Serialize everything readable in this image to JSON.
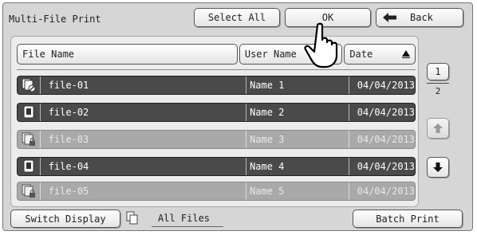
{
  "window": {
    "title": "Multi-File Print"
  },
  "toolbar": {
    "select_all": "Select All",
    "ok": "OK",
    "back": "Back"
  },
  "columns": {
    "file_name": "File Name",
    "user_name": "User Name",
    "date": "Date"
  },
  "files": [
    {
      "icon": "stapled-doc-icon",
      "name": "file-01",
      "user": "Name 1",
      "date": "04/04/2013",
      "selected": true
    },
    {
      "icon": "doc-icon",
      "name": "file-02",
      "user": "Name 2",
      "date": "04/04/2013",
      "selected": true
    },
    {
      "icon": "locked-doc-icon",
      "name": "file-03",
      "user": "Name 3",
      "date": "04/04/2013",
      "selected": false
    },
    {
      "icon": "doc-icon",
      "name": "file-04",
      "user": "Name 4",
      "date": "04/04/2013",
      "selected": true
    },
    {
      "icon": "locked-doc-icon",
      "name": "file-05",
      "user": "Name 5",
      "date": "04/04/2013",
      "selected": false
    }
  ],
  "pager": {
    "current": "1",
    "total": "2"
  },
  "bottom": {
    "switch_display": "Switch Display",
    "all_files": "All Files",
    "batch_print": "Batch Print"
  }
}
